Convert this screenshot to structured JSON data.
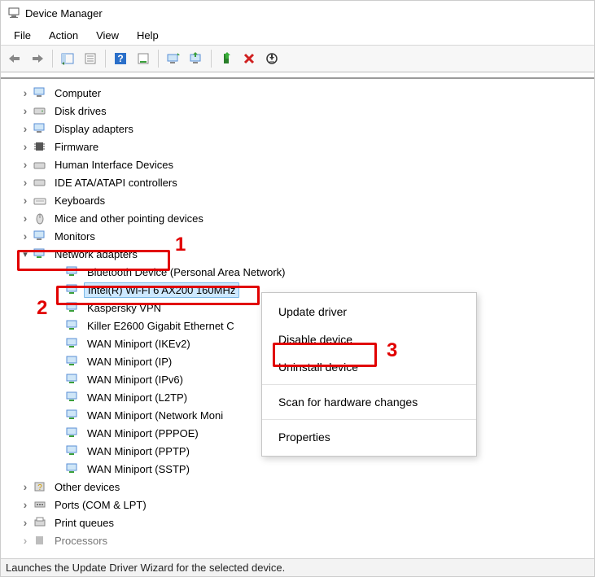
{
  "window": {
    "title": "Device Manager"
  },
  "menu": {
    "file": "File",
    "action": "Action",
    "view": "View",
    "help": "Help"
  },
  "tree": {
    "computer": "Computer",
    "disk_drives": "Disk drives",
    "display_adapters": "Display adapters",
    "firmware": "Firmware",
    "hid": "Human Interface Devices",
    "ide": "IDE ATA/ATAPI controllers",
    "keyboards": "Keyboards",
    "mice": "Mice and other pointing devices",
    "monitors": "Monitors",
    "network_adapters": "Network adapters",
    "na_children": {
      "bt": "Bluetooth Device (Personal Area Network)",
      "intel": "Intel(R) Wi-Fi 6 AX200 160MHz",
      "kasp": "Kaspersky VPN",
      "killer": "Killer E2600 Gigabit Ethernet C",
      "wm_ikev2": "WAN Miniport (IKEv2)",
      "wm_ip": "WAN Miniport (IP)",
      "wm_ipv6": "WAN Miniport (IPv6)",
      "wm_l2tp": "WAN Miniport (L2TP)",
      "wm_netmon": "WAN Miniport (Network Moni",
      "wm_pppoe": "WAN Miniport (PPPOE)",
      "wm_pptp": "WAN Miniport (PPTP)",
      "wm_sstp": "WAN Miniport (SSTP)"
    },
    "other_devices": "Other devices",
    "ports": "Ports (COM & LPT)",
    "print_queues": "Print queues",
    "processors": "Processors"
  },
  "context_menu": {
    "update": "Update driver",
    "disable": "Disable device",
    "uninstall": "Uninstall device",
    "scan": "Scan for hardware changes",
    "properties": "Properties"
  },
  "annotations": {
    "n1": "1",
    "n2": "2",
    "n3": "3"
  },
  "statusbar": "Launches the Update Driver Wizard for the selected device."
}
